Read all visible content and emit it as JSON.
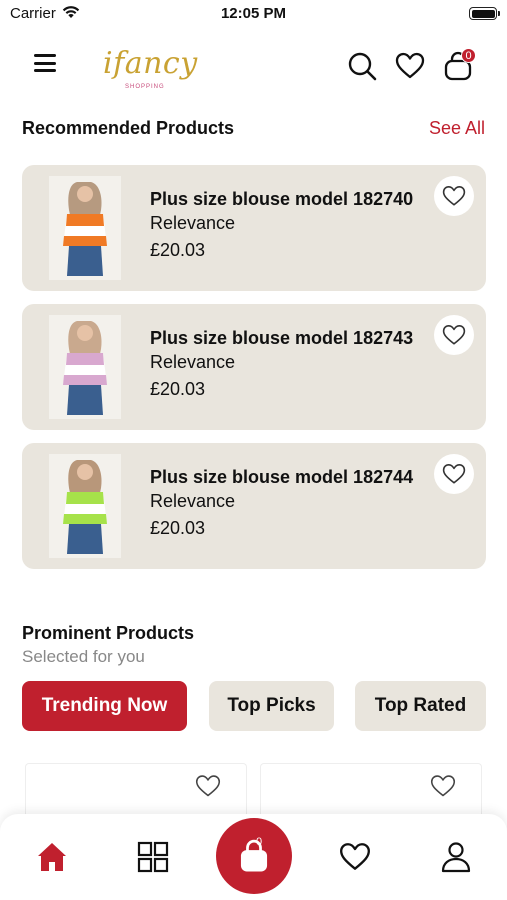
{
  "status_bar": {
    "carrier": "Carrier",
    "time": "12:05 PM"
  },
  "header": {
    "logo_text": "ifancy",
    "logo_subtext": "SHOPPING",
    "cart_count": "0"
  },
  "recommended": {
    "title": "Recommended Products",
    "see_all": "See All",
    "products": [
      {
        "name": "Plus size blouse model 182740",
        "subtitle": "Relevance",
        "price": "£20.03",
        "shirt_color": "#f07a25"
      },
      {
        "name": "Plus size blouse model 182743",
        "subtitle": "Relevance",
        "price": "£20.03",
        "shirt_color": "#d8a8cf"
      },
      {
        "name": "Plus size blouse model 182744",
        "subtitle": "Relevance",
        "price": "£20.03",
        "shirt_color": "#a6e24a"
      }
    ]
  },
  "prominent": {
    "title": "Prominent Products",
    "subtitle": "Selected for you",
    "tabs": [
      "Trending Now",
      "Top Picks",
      "Top Rated"
    ],
    "active_tab": "Trending Now"
  },
  "bottom_nav": {
    "items": [
      "home-icon",
      "categories-icon",
      "cart-icon",
      "wishlist-icon",
      "account-icon"
    ],
    "cart_count": "0",
    "active": "home"
  },
  "colors": {
    "accent": "#c0202e",
    "card_bg": "#e9e5dd",
    "logo_gold": "#c9a233"
  }
}
